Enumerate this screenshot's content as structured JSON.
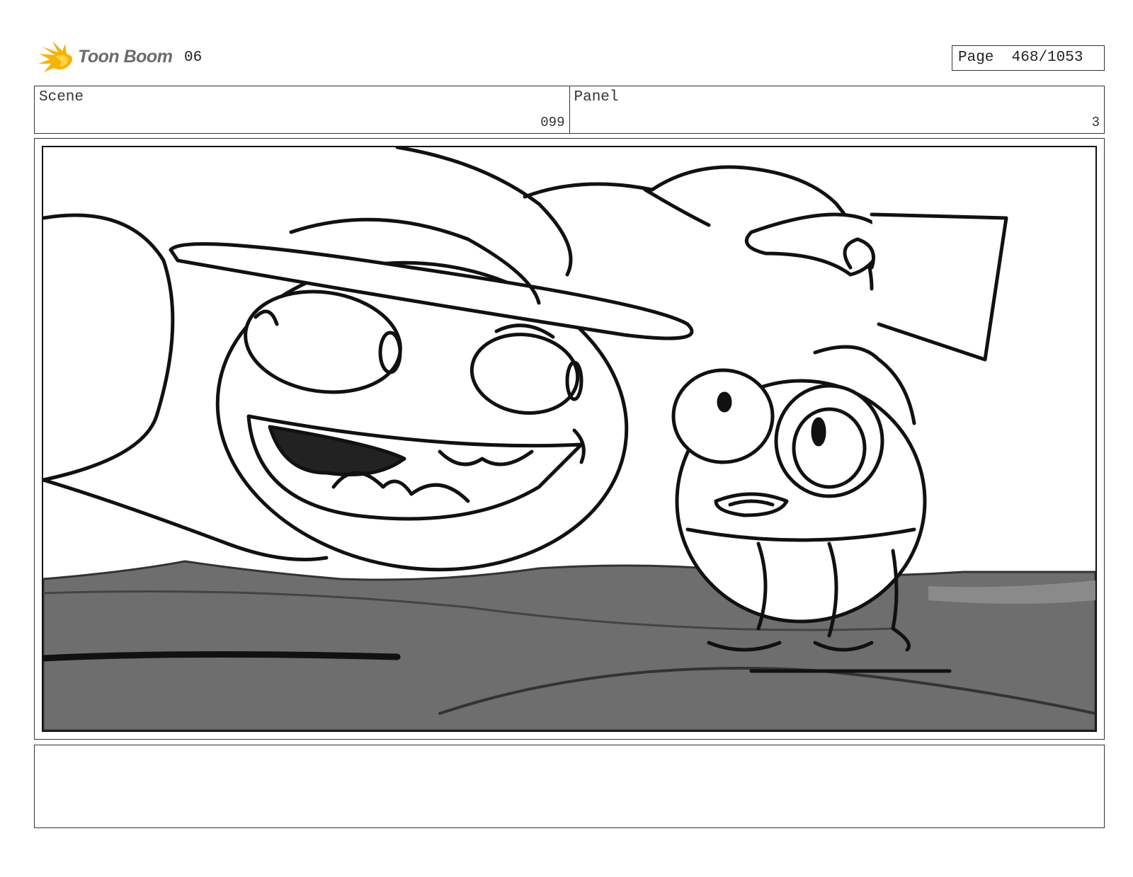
{
  "header": {
    "brand_name": "Toon Boom",
    "episode": "06",
    "page_label": "Page",
    "page_number": "468/1053"
  },
  "info": {
    "scene_label": "Scene",
    "scene_value": "099",
    "panel_label": "Panel",
    "panel_value": "3"
  },
  "panel": {
    "icon": "storyboard-sketch"
  },
  "notes": {
    "text": ""
  },
  "colors": {
    "logo_accent": "#F5B400",
    "ground": "#6e6e6e",
    "ink": "#111111"
  }
}
